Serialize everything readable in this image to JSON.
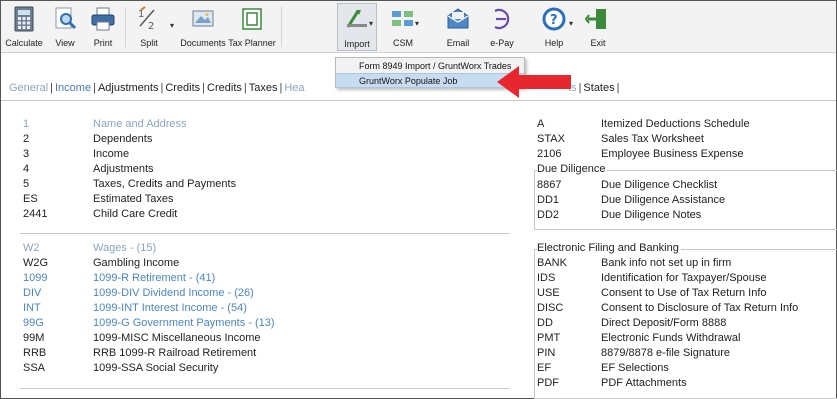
{
  "toolbar": {
    "buttons": [
      {
        "label": "Calculate",
        "icon": "calculator-icon"
      },
      {
        "label": "View",
        "icon": "magnifier-icon"
      },
      {
        "label": "Print",
        "icon": "printer-icon"
      },
      {
        "label": "Split",
        "icon": "split-icon"
      },
      {
        "label": "Documents",
        "icon": "documents-icon"
      },
      {
        "label": "Tax Planner",
        "icon": "tax-planner-icon"
      },
      {
        "label": "Import",
        "icon": "import-icon"
      },
      {
        "label": "CSM",
        "icon": "csm-icon"
      },
      {
        "label": "Email",
        "icon": "email-icon"
      },
      {
        "label": "e-Pay",
        "icon": "epay-icon"
      },
      {
        "label": "Help",
        "icon": "help-icon"
      },
      {
        "label": "Exit",
        "icon": "exit-icon"
      }
    ]
  },
  "import_menu": {
    "items": [
      {
        "label": "Form 8949 Import / GruntWorx Trades",
        "highlighted": false
      },
      {
        "label": "GruntWorx Populate Job",
        "highlighted": true
      }
    ]
  },
  "tabs": {
    "left": [
      "General",
      "Income",
      "Adjustments",
      "Credits",
      "Credits",
      "Taxes",
      "Hea"
    ],
    "right": [
      "ts",
      "States"
    ],
    "selected_index": 1
  },
  "general_forms": [
    {
      "code": "1",
      "desc": "Name and Address",
      "style": "dim"
    },
    {
      "code": "2",
      "desc": "Dependents",
      "style": "normal"
    },
    {
      "code": "3",
      "desc": "Income",
      "style": "normal"
    },
    {
      "code": "4",
      "desc": "Adjustments",
      "style": "normal"
    },
    {
      "code": "5",
      "desc": "Taxes, Credits and Payments",
      "style": "normal"
    },
    {
      "code": "ES",
      "desc": "Estimated Taxes",
      "style": "normal"
    },
    {
      "code": "2441",
      "desc": "Child Care Credit",
      "style": "normal"
    }
  ],
  "income_forms": [
    {
      "code": "W2",
      "desc": "Wages - (15)",
      "style": "dim"
    },
    {
      "code": "W2G",
      "desc": "Gambling Income",
      "style": "normal"
    },
    {
      "code": "1099",
      "desc": "1099-R  Retirement - (41)",
      "style": "blue"
    },
    {
      "code": "DIV",
      "desc": "1099-DIV  Dividend Income - (26)",
      "style": "blue"
    },
    {
      "code": "INT",
      "desc": "1099-INT  Interest Income - (54)",
      "style": "blue"
    },
    {
      "code": "99G",
      "desc": "1099-G  Government Payments - (13)",
      "style": "blue"
    },
    {
      "code": "99M",
      "desc": "1099-MISC  Miscellaneous Income",
      "style": "normal"
    },
    {
      "code": "RRB",
      "desc": "RRB 1099-R  Railroad Retirement",
      "style": "normal"
    },
    {
      "code": "SSA",
      "desc": "1099-SSA  Social Security",
      "style": "normal"
    }
  ],
  "right_top_forms": [
    {
      "code": "A",
      "desc": "Itemized Deductions Schedule"
    },
    {
      "code": "STAX",
      "desc": "Sales Tax Worksheet"
    },
    {
      "code": "2106",
      "desc": "Employee Business Expense"
    }
  ],
  "due_diligence": {
    "title": "Due Diligence",
    "items": [
      {
        "code": "8867",
        "desc": "Due Diligence Checklist"
      },
      {
        "code": "DD1",
        "desc": "Due Diligence Assistance"
      },
      {
        "code": "DD2",
        "desc": "Due Diligence Notes"
      }
    ]
  },
  "efile": {
    "title": "Electronic Filing and Banking",
    "items": [
      {
        "code": "BANK",
        "desc": "Bank info not set up in firm"
      },
      {
        "code": "IDS",
        "desc": "Identification for Taxpayer/Spouse"
      },
      {
        "code": "USE",
        "desc": "Consent to Use of Tax Return Info"
      },
      {
        "code": "DISC",
        "desc": "Consent to Disclosure of Tax Return Info"
      },
      {
        "code": "DD",
        "desc": "Direct Deposit/Form 8888"
      },
      {
        "code": "PMT",
        "desc": "Electronic Funds Withdrawal"
      },
      {
        "code": "PIN",
        "desc": "8879/8878 e-file Signature"
      },
      {
        "code": "EF",
        "desc": "EF Selections"
      },
      {
        "code": "PDF",
        "desc": "PDF Attachments"
      }
    ]
  },
  "colors": {
    "link_blue": "#4a86c8",
    "dim_blue": "#8aa6c8",
    "highlight": "#c8dcf1",
    "arrow_red": "#e8262d"
  }
}
